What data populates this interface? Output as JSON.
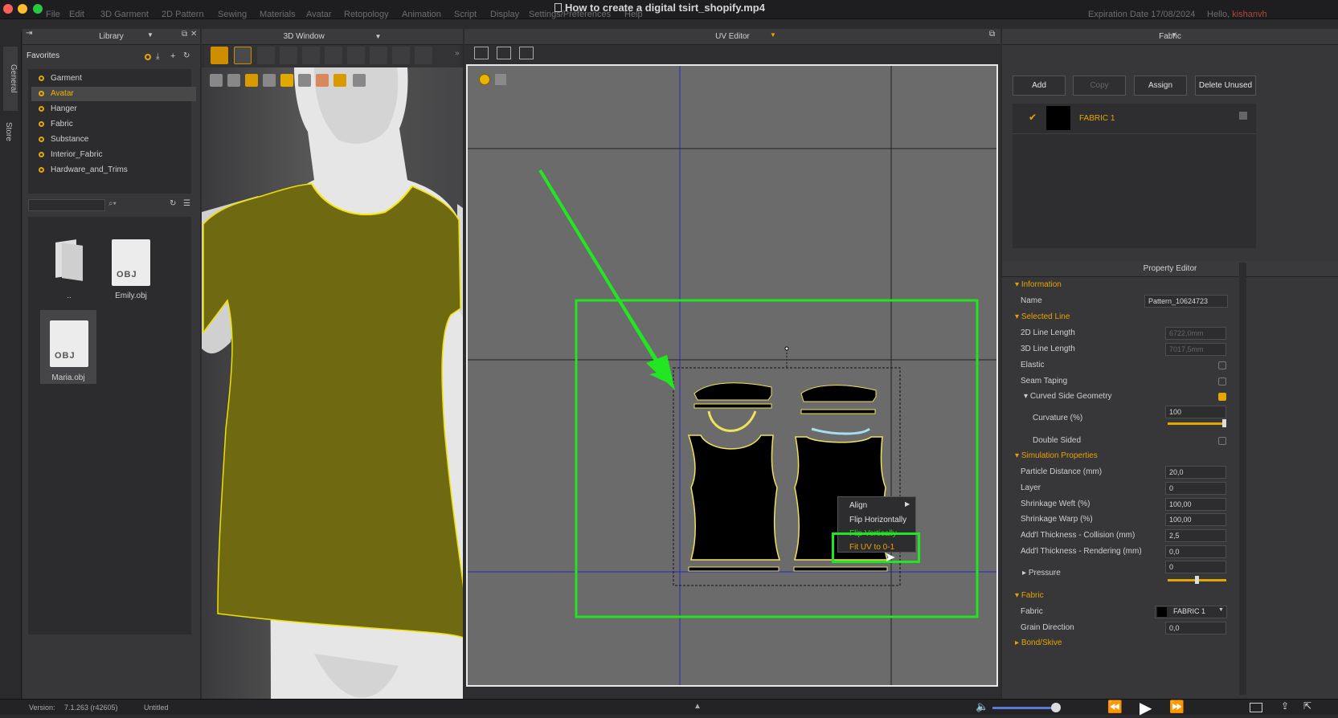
{
  "window": {
    "title": "How to create a digital tsirt_shopify.mp4",
    "menus": [
      "File",
      "Edit",
      "3D Garment",
      "2D Pattern",
      "Sewing",
      "Materials",
      "Avatar",
      "Retopology",
      "Animation",
      "Script",
      "Display",
      "Settings/Preferences",
      "Help"
    ],
    "expiration": "Expiration Date 17/08/2024",
    "hello_prefix": "Hello,",
    "user": "kishanvh"
  },
  "left_tabs": [
    "General",
    "Store"
  ],
  "library": {
    "header": "Library",
    "favorites_label": "Favorites",
    "items": [
      "Garment",
      "Avatar",
      "Hanger",
      "Fabric",
      "Substance",
      "Interior_Fabric",
      "Hardware_and_Trims"
    ],
    "selected": "Avatar",
    "files": [
      {
        "name": "..",
        "type": "folder"
      },
      {
        "name": "Emily.obj",
        "type": "obj",
        "badge": "OBJ"
      },
      {
        "name": "Maria.obj",
        "type": "obj",
        "badge": "OBJ"
      }
    ]
  },
  "window3d": {
    "header": "3D Window",
    "garment_color": "#6f6a12"
  },
  "uv_editor": {
    "header": "UV Editor"
  },
  "context_menu": {
    "items": [
      "Align",
      "Flip Horizontally",
      "Flip Vertically",
      "Fit UV to 0-1"
    ],
    "highlighted": "Fit UV to 0-1"
  },
  "fabric_panel": {
    "header": "Fabric",
    "buttons": [
      "Add",
      "Copy",
      "Assign",
      "Delete Unused"
    ],
    "fabric_name": "FABRIC 1"
  },
  "property_editor": {
    "header": "Property Editor",
    "information": "Information",
    "name_label": "Name",
    "name_value": "Pattern_10624723",
    "selected_line": "Selected Line",
    "line2d_label": "2D Line Length",
    "line2d_value": "6722,0mm",
    "line3d_label": "3D Line Length",
    "line3d_value": "7017,5mm",
    "elastic": "Elastic",
    "seam_taping": "Seam Taping",
    "curved_side": "Curved Side Geometry",
    "curvature_label": "Curvature (%)",
    "curvature_value": "100",
    "double_sided": "Double Sided",
    "sim_props": "Simulation Properties",
    "particle_label": "Particle Distance (mm)",
    "particle_value": "20,0",
    "layer_label": "Layer",
    "layer_value": "0",
    "weft_label": "Shrinkage Weft (%)",
    "weft_value": "100,00",
    "warp_label": "Shrinkage Warp (%)",
    "warp_value": "100,00",
    "collision_label": "Add'l Thickness - Collision (mm)",
    "collision_value": "2,5",
    "rendering_label": "Add'l Thickness - Rendering (mm)",
    "rendering_value": "0,0",
    "pressure_label": "Pressure",
    "pressure_value": "0",
    "fabric_section": "Fabric",
    "fabric_label": "Fabric",
    "fabric_value": "FABRIC 1",
    "grain_label": "Grain Direction",
    "grain_value": "0,0",
    "bond": "Bond/Skive"
  },
  "statusbar": {
    "version_label": "Version:",
    "version": "7.1.263 (r42605)",
    "project": "Untitled"
  },
  "colors": {
    "accent": "#e6a600",
    "highlight_green": "#19e619",
    "uv_bg": "#6b6b6b"
  }
}
